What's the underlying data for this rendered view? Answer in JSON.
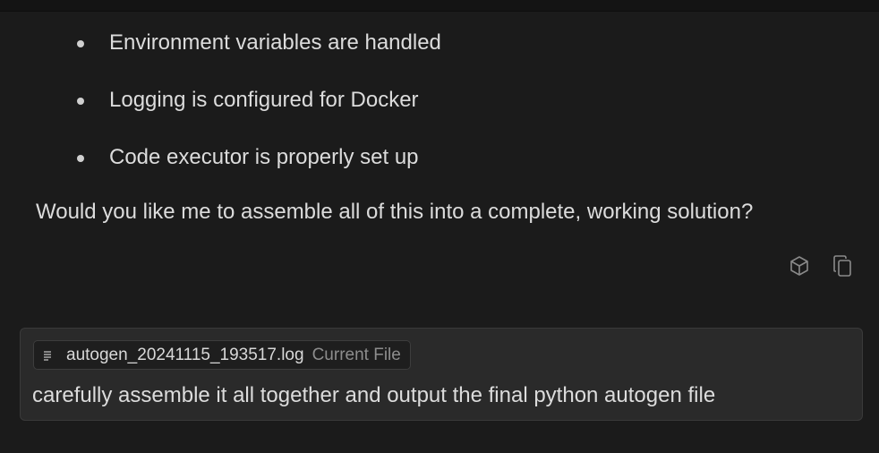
{
  "message": {
    "bullets": [
      "Environment variables are handled",
      "Logging is configured for Docker",
      "Code executor is properly set up"
    ],
    "question": "Would you like me to assemble all of this into a complete, working solution?",
    "actions": [
      {
        "icon": "cube-icon"
      },
      {
        "icon": "copy-icon"
      }
    ]
  },
  "composer": {
    "attachment": {
      "icon": "file-text-icon",
      "file_name": "autogen_20241115_193517.log",
      "tag": "Current File"
    },
    "input_text": "carefully assemble it all together and output the final python autogen file"
  }
}
